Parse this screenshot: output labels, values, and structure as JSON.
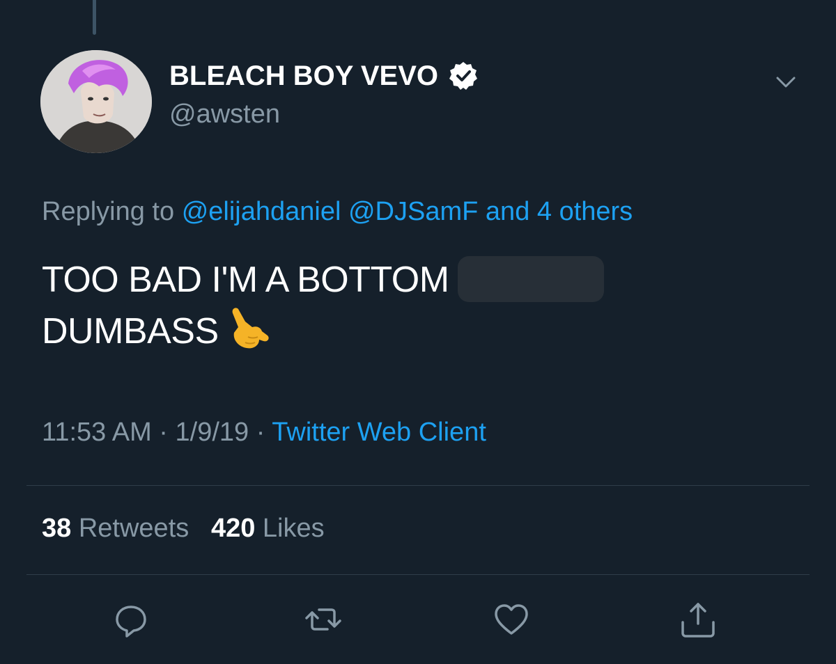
{
  "tweet": {
    "display_name": "BLEACH BOY VEVO",
    "handle": "@awsten",
    "replying_prefix": "Replying to",
    "replying_mentions": [
      "@elijahdaniel",
      "@DJSamF",
      "and 4 others"
    ],
    "text_line1": "TOO BAD I'M A BOTTOM",
    "text_line2": "DUMBASS",
    "emoji": "call-me-hand-emoji",
    "time": "11:53 AM",
    "date": "1/9/19",
    "separator": "·",
    "client": "Twitter Web Client",
    "retweets_count": "38",
    "retweets_label": "Retweets",
    "likes_count": "420",
    "likes_label": "Likes"
  },
  "icons": {
    "verified": "verified-badge-icon",
    "menu": "chevron-down-icon",
    "reply": "reply-icon",
    "retweet": "retweet-icon",
    "like": "heart-icon",
    "share": "share-icon"
  },
  "colors": {
    "background": "#15202b",
    "accent": "#1da1f2",
    "secondary_text": "#8899a6",
    "divider": "#2f3d4a"
  }
}
